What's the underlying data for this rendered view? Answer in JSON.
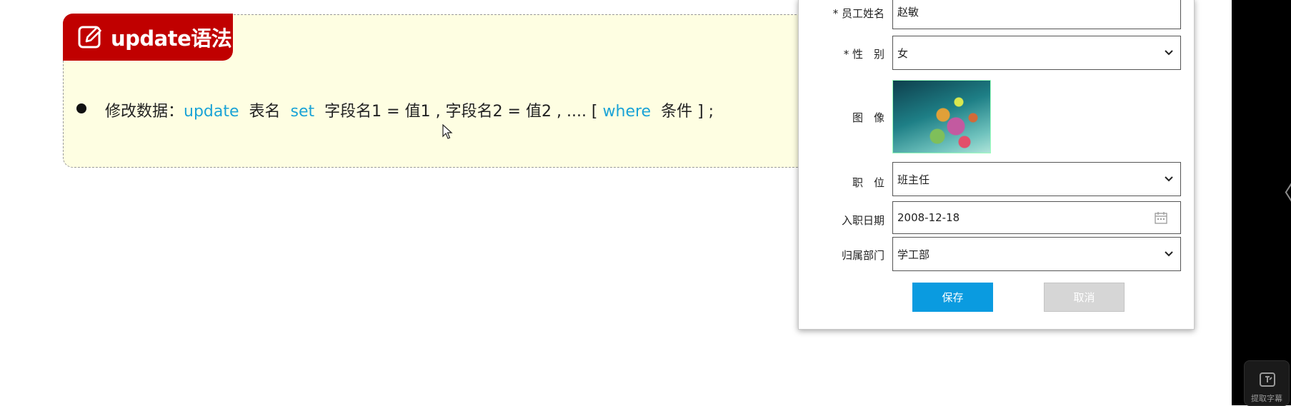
{
  "slide": {
    "title": "update语法",
    "syntax": {
      "prefix": "修改数据：",
      "kw_update": "update",
      "table": "表名",
      "kw_set": "set",
      "assignments": "字段名1 = 值1 , 字段名2 = 值2 , .... [",
      "kw_where": "where",
      "condition": "条件 ] ;"
    }
  },
  "form": {
    "name": {
      "label": "* 员工姓名",
      "value": "赵敏"
    },
    "gender": {
      "label": "* 性　别",
      "value": "女"
    },
    "image": {
      "label": "图　像"
    },
    "position": {
      "label": "职　位",
      "value": "班主任"
    },
    "entry_date": {
      "label": "入职日期",
      "value": "2008-12-18"
    },
    "department": {
      "label": "归属部门",
      "value": "学工部"
    },
    "save_label": "保存",
    "cancel_label": "取消"
  },
  "side_panel": {
    "collapse_glyph": "〈",
    "subtitle_button_label": "提取字幕"
  },
  "colors": {
    "title_bg": "#c00000",
    "keyword": "#1aa3d6",
    "save_button": "#0a9be0",
    "cancel_button": "#d6d6d6",
    "slide_bg": "#fefee2"
  }
}
